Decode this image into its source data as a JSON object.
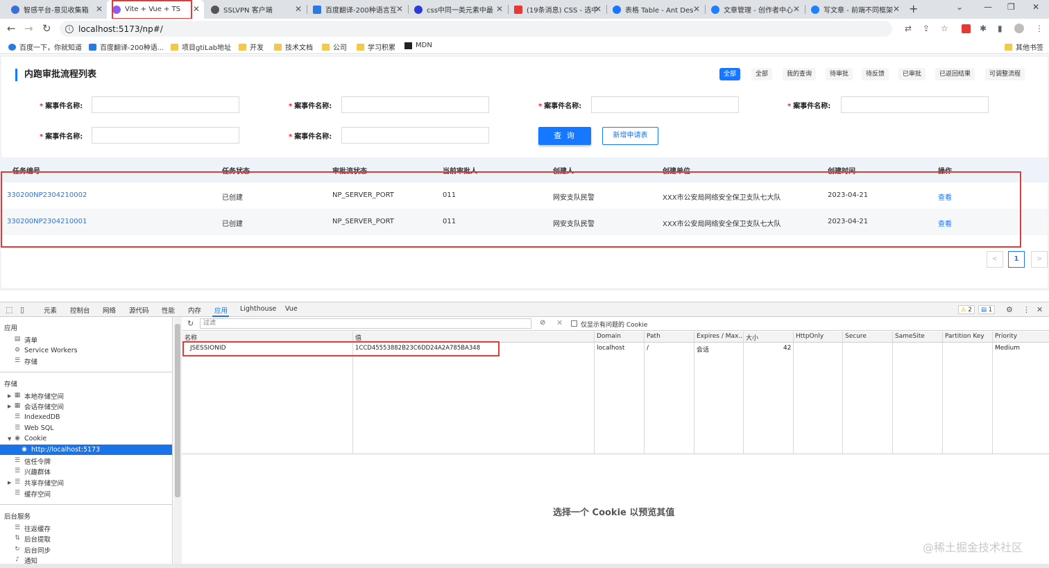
{
  "tabs": [
    {
      "label": "智感平台-意见收集箱",
      "color": "#3b6fd8"
    },
    {
      "label": "Vite + Vue + TS",
      "color": "#8e5cf5"
    },
    {
      "label": "SSLVPN 客户端",
      "color": "#555555"
    },
    {
      "label": "百度翻译-200种语言互",
      "color": "#2a7ae2"
    },
    {
      "label": "css中同一类元素中最",
      "color": "#2a3bd8"
    },
    {
      "label": "(19条消息) CSS - 选中",
      "color": "#e53935"
    },
    {
      "label": "表格 Table - Ant Des",
      "color": "#1677ff"
    },
    {
      "label": "文章管理 - 创作者中心",
      "color": "#1e80ff"
    },
    {
      "label": "写文章 - 前端不同框架",
      "color": "#1e80ff"
    }
  ],
  "address": {
    "url": "localhost:5173/np#/"
  },
  "bookmarks": [
    {
      "label": "百度一下，你就知道"
    },
    {
      "label": "百度翻译-200种语..."
    },
    {
      "label": "项目gtiLab地址"
    },
    {
      "label": "开发"
    },
    {
      "label": "技术文档"
    },
    {
      "label": "公司"
    },
    {
      "label": "学习积累"
    },
    {
      "label": "MDN"
    },
    {
      "label": "其他书签"
    }
  ],
  "page": {
    "title": "内跑审批流程列表",
    "filters": [
      "全部",
      "全部",
      "我的查询",
      "待审批",
      "待反馈",
      "已审批",
      "已返回结果",
      "可调整流程"
    ],
    "form_label": "案事件名称:",
    "required_mark": "*",
    "query_button": "查 询",
    "new_button": "新增申请表",
    "columns": [
      "任务编号",
      "任务状态",
      "审批流状态",
      "当前审批人",
      "创建人",
      "创建单位",
      "创建时间",
      "操作"
    ],
    "rows": [
      [
        "330200NP2304210002",
        "已创建",
        "NP_SERVER_PORT",
        "011",
        "网安支队民警",
        "XXX市公安局网络安全保卫支队七大队",
        "2023-04-21",
        "查看"
      ],
      [
        "330200NP2304210001",
        "已创建",
        "NP_SERVER_PORT",
        "011",
        "网安支队民警",
        "XXX市公安局网络安全保卫支队七大队",
        "2023-04-21",
        "查看"
      ]
    ],
    "pager": {
      "prev": "<",
      "current": "1",
      "next": ">"
    }
  },
  "devtools": {
    "tabs": [
      "元素",
      "控制台",
      "网络",
      "源代码",
      "性能",
      "内存",
      "应用",
      "Lighthouse",
      "Vue"
    ],
    "warn_count": "2",
    "msg_count": "1",
    "sidebar": {
      "app_title": "应用",
      "app_items": [
        "清单",
        "Service Workers",
        "存储"
      ],
      "storage_title": "存储",
      "storage_items": [
        "本地存储空间",
        "会话存储空间",
        "IndexedDB",
        "Web SQL",
        "Cookie"
      ],
      "cookie_origin": "http://localhost:5173",
      "more_items": [
        "信任令牌",
        "兴趣群体",
        "共享存储空间",
        "缓存空间"
      ],
      "bg_title": "后台服务",
      "bg_items": [
        "往返缓存",
        "后台提取",
        "后台同步",
        "通知"
      ]
    },
    "filter_placeholder": "过滤",
    "only_issues_label": "仅显示有问题的 Cookie",
    "cookie_columns": [
      "名称",
      "值",
      "Domain",
      "Path",
      "Expires / Max...",
      "大小",
      "HttpOnly",
      "Secure",
      "SameSite",
      "Partition Key",
      "Priority"
    ],
    "cookie_row": {
      "name": "JSESSIONID",
      "value": "1CCD45553882B23C6DD24A2A785BA348",
      "domain": "localhost",
      "path": "/",
      "expires": "会话",
      "size": "42",
      "priority": "Medium"
    },
    "preview_message": "选择一个 Cookie 以预览其值"
  },
  "watermark": "@稀土掘金技术社区",
  "colors": {
    "primary": "#1677ff",
    "highlight": "#e53935",
    "devtools_accent": "#1a73e8"
  }
}
